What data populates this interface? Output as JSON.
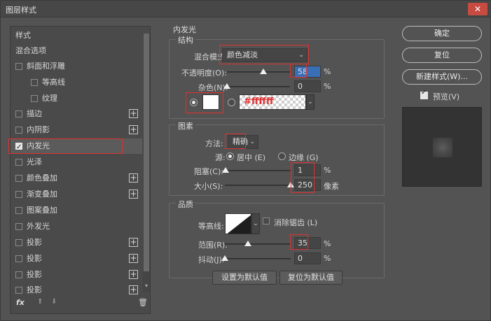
{
  "window": {
    "title": "图层样式",
    "close_glyph": "✕"
  },
  "left": {
    "items": [
      {
        "label": "样式"
      },
      {
        "label": "混合选项"
      },
      {
        "label": "斜面和浮雕"
      },
      {
        "label": "等高线"
      },
      {
        "label": "纹理"
      },
      {
        "label": "描边"
      },
      {
        "label": "内阴影"
      },
      {
        "label": "内发光"
      },
      {
        "label": "光泽"
      },
      {
        "label": "颜色叠加"
      },
      {
        "label": "渐变叠加"
      },
      {
        "label": "图案叠加"
      },
      {
        "label": "外发光"
      },
      {
        "label": "投影"
      },
      {
        "label": "投影"
      },
      {
        "label": "投影"
      },
      {
        "label": "投影"
      }
    ],
    "fx_label": "fx",
    "up_glyph": "⬆",
    "down_glyph": "⬇",
    "trash_glyph": "🗑"
  },
  "inner_glow": {
    "section_title": "内发光",
    "structure": {
      "title": "结构",
      "blend_mode_label": "混合模式:",
      "blend_mode_value": "颜色减淡",
      "opacity_label": "不透明度(O):",
      "opacity_value": "58",
      "opacity_level": 0.58,
      "noise_label": "杂色(N):",
      "noise_value": "0",
      "noise_level": 0,
      "percent": "%",
      "gradient_hex": "#ffffff"
    },
    "elements": {
      "title": "图素",
      "method_label": "方法:",
      "method_value": "精确",
      "source_label": "源:",
      "source_center": "居中 (E)",
      "source_edge": "边缘 (G)",
      "choke_label": "阻塞(C):",
      "choke_value": "1",
      "choke_level": 0.01,
      "size_label": "大小(S):",
      "size_value": "250",
      "size_level": 1.0,
      "size_unit": "像素",
      "percent": "%"
    },
    "quality": {
      "title": "品质",
      "contour_label": "等高线:",
      "antialias_label": "消除锯齿 (L)",
      "range_label": "范围(R):",
      "range_value": "35",
      "range_level": 0.35,
      "jitter_label": "抖动(J):",
      "jitter_value": "0",
      "jitter_level": 0,
      "percent": "%"
    },
    "set_default_label": "设置为默认值",
    "reset_default_label": "复位为默认值"
  },
  "right": {
    "ok_label": "确定",
    "reset_label": "复位",
    "new_style_label": "新建样式(W)...",
    "preview_label": "预览(V)"
  }
}
